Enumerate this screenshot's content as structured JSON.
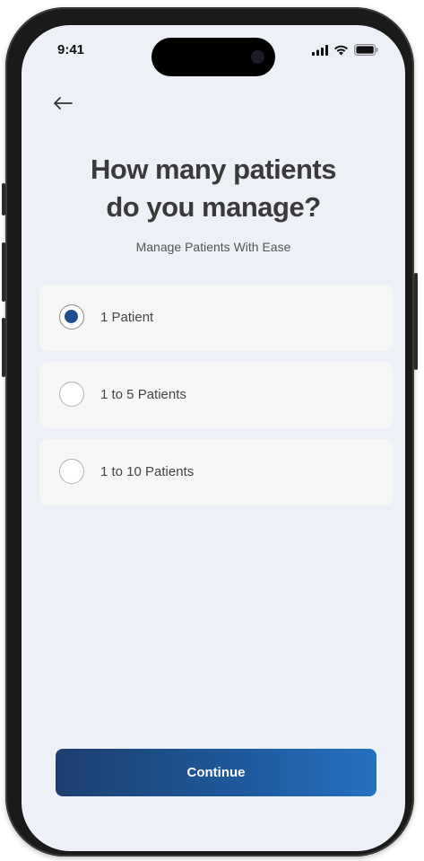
{
  "status_bar": {
    "time": "9:41"
  },
  "header": {
    "title_line1": "How many patients",
    "title_line2": "do you manage?",
    "subtitle": "Manage Patients With Ease"
  },
  "options": [
    {
      "label": "1 Patient",
      "selected": true
    },
    {
      "label": "1 to 5 Patients",
      "selected": false
    },
    {
      "label": "1 to 10 Patients",
      "selected": false
    }
  ],
  "footer": {
    "continue_label": "Continue"
  },
  "colors": {
    "background": "#edf0f7",
    "card": "#f7f7f7",
    "accent": "#1f4f8f",
    "button_gradient_start": "#1d3f6f",
    "button_gradient_end": "#2571c0"
  },
  "icons": {
    "back": "arrow-left-icon",
    "signal": "cellular-signal-icon",
    "wifi": "wifi-icon",
    "battery": "battery-icon"
  }
}
